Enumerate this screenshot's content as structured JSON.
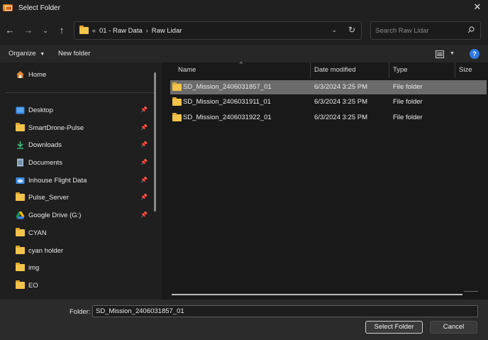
{
  "window": {
    "title": "Select Folder"
  },
  "navigation": {
    "breadcrumb": [
      "01 - Raw Data",
      "Raw Lidar"
    ],
    "overflow_glyph": "«"
  },
  "search": {
    "placeholder": "Search Raw Lidar"
  },
  "toolbar": {
    "organize_label": "Organize",
    "new_folder_label": "New folder"
  },
  "sidebar": {
    "home": "Home",
    "items": [
      {
        "label": "Desktop",
        "icon": "desktop-icon",
        "pinned": true
      },
      {
        "label": "SmartDrone-Pulse",
        "icon": "folder-icon",
        "pinned": true
      },
      {
        "label": "Downloads",
        "icon": "download-icon",
        "pinned": true
      },
      {
        "label": "Documents",
        "icon": "documents-icon",
        "pinned": true
      },
      {
        "label": "Inhouse Flight Data",
        "icon": "cloud-folder-icon",
        "pinned": true
      },
      {
        "label": "Pulse_Server",
        "icon": "folder-icon",
        "pinned": true
      },
      {
        "label": "Google Drive (G:)",
        "icon": "google-drive-icon",
        "pinned": true
      },
      {
        "label": "CYAN",
        "icon": "folder-icon",
        "pinned": false
      },
      {
        "label": "cyan holder",
        "icon": "folder-icon",
        "pinned": false
      },
      {
        "label": "img",
        "icon": "folder-icon",
        "pinned": false
      },
      {
        "label": "EO",
        "icon": "folder-icon",
        "pinned": false
      }
    ]
  },
  "file_list": {
    "columns": {
      "name": "Name",
      "date": "Date modified",
      "type": "Type",
      "size": "Size"
    },
    "rows": [
      {
        "name": "SD_Mission_2406031857_01",
        "date": "6/3/2024 3:25 PM",
        "type": "File folder",
        "selected": true
      },
      {
        "name": "SD_Mission_2406031911_01",
        "date": "6/3/2024 3:25 PM",
        "type": "File folder",
        "selected": false
      },
      {
        "name": "SD_Mission_2406031922_01",
        "date": "6/3/2024 3:25 PM",
        "type": "File folder",
        "selected": false
      }
    ]
  },
  "footer": {
    "folder_label": "Folder:",
    "folder_value": "SD_Mission_2406031857_01",
    "select_button": "Select Folder",
    "cancel_button": "Cancel"
  },
  "colors": {
    "accent": "#2e7ae0",
    "selection": "#6b6b6b",
    "folder": "#f3c44a"
  }
}
